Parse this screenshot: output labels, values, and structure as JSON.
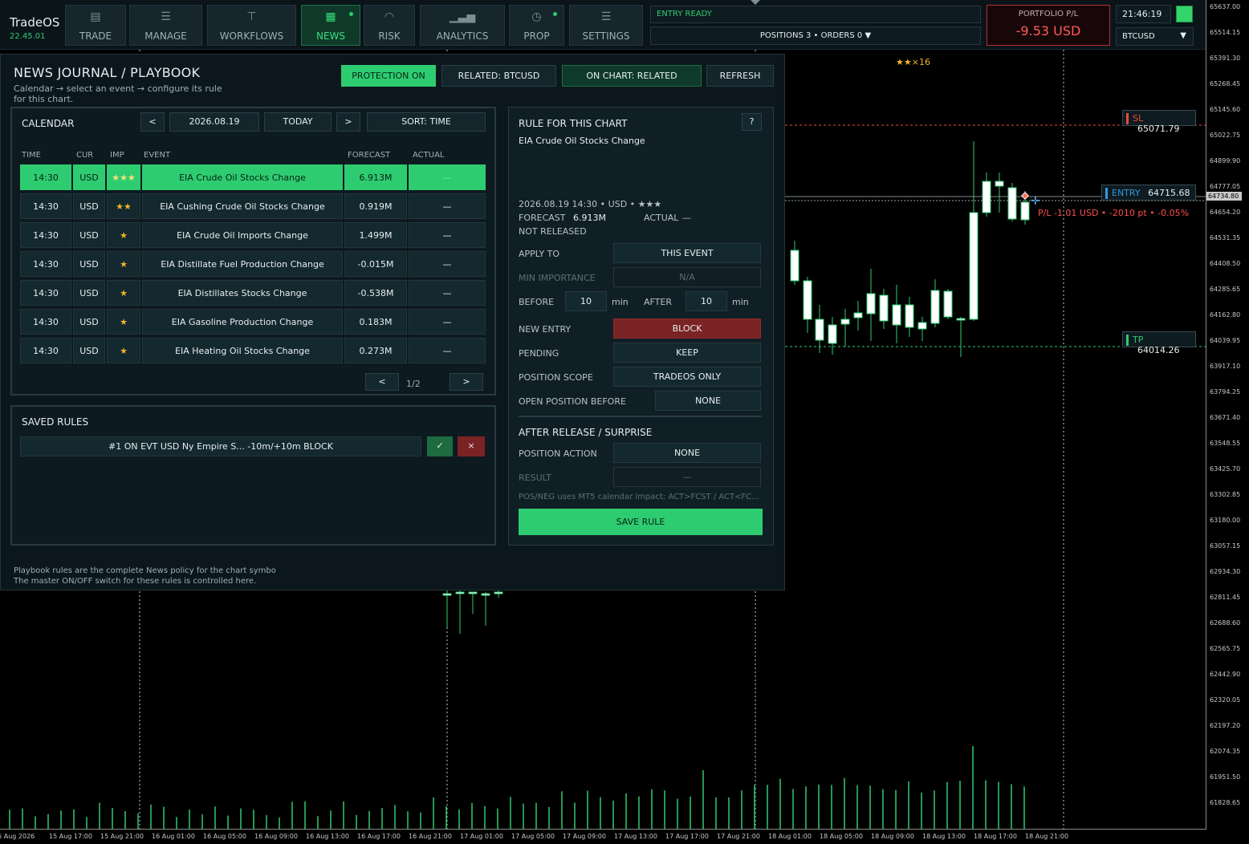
{
  "app": {
    "name": "TradeOS",
    "version": "22.45.01"
  },
  "nav": [
    {
      "label": "TRADE",
      "icon": "document-icon",
      "glyph": "▤",
      "active": false,
      "dot": false
    },
    {
      "label": "MANAGE",
      "icon": "sliders-icon",
      "glyph": "☰",
      "active": false,
      "dot": false
    },
    {
      "label": "WORKFLOWS",
      "icon": "flow-icon",
      "glyph": "⊤",
      "active": false,
      "dot": false
    },
    {
      "label": "NEWS",
      "icon": "calendar-icon",
      "glyph": "▦",
      "active": true,
      "dot": true
    },
    {
      "label": "RISK",
      "icon": "shield-icon",
      "glyph": "◠",
      "active": false,
      "dot": false
    },
    {
      "label": "ANALYTICS",
      "icon": "bar-chart-icon",
      "glyph": "▁▃▅",
      "active": false,
      "dot": false
    },
    {
      "label": "PROP",
      "icon": "timer-icon",
      "glyph": "◷",
      "active": false,
      "dot": true
    },
    {
      "label": "SETTINGS",
      "icon": "settings-sliders-icon",
      "glyph": "☰",
      "active": false,
      "dot": false
    }
  ],
  "status": {
    "entry": "ENTRY READY",
    "positions_orders": "POSITIONS 3  •  ORDERS 0  ▼",
    "portfolio_label": "PORTFOLIO P/L",
    "portfolio_value": "-9.53 USD",
    "clock": "21:46:19",
    "symbol": "BTCUSD"
  },
  "chart": {
    "price_ticks": [
      "65637.00",
      "65514.15",
      "65391.30",
      "65268.45",
      "65145.60",
      "65022.75",
      "64899.90",
      "64777.05",
      "64654.20",
      "64531.35",
      "64408.50",
      "64285.65",
      "64162.80",
      "64039.95",
      "63917.10",
      "63794.25",
      "63671.40",
      "63548.55",
      "63425.70",
      "63302.85",
      "63180.00",
      "63057.15",
      "62934.30",
      "62811.45",
      "62688.60",
      "62565.75",
      "62442.90",
      "62320.05",
      "62197.20",
      "62074.35",
      "61951.50",
      "61828.65"
    ],
    "time_ticks": [
      "15 Aug 2026",
      "15 Aug 17:00",
      "15 Aug 21:00",
      "16 Aug 01:00",
      "16 Aug 05:00",
      "16 Aug 09:00",
      "16 Aug 13:00",
      "16 Aug 17:00",
      "16 Aug 21:00",
      "17 Aug 01:00",
      "17 Aug 05:00",
      "17 Aug 09:00",
      "17 Aug 13:00",
      "17 Aug 17:00",
      "17 Aug 21:00",
      "18 Aug 01:00",
      "18 Aug 05:00",
      "18 Aug 09:00",
      "18 Aug 13:00",
      "18 Aug 17:00",
      "18 Aug 21:00"
    ],
    "sl": {
      "label": "SL",
      "value": "65071.79",
      "color": "#e74c3c"
    },
    "entry": {
      "label": "ENTRY",
      "value": "64715.68",
      "color": "#3498db"
    },
    "tp": {
      "label": "TP",
      "value": "64014.26",
      "color": "#2ecc71"
    },
    "bid_price": "64734.80",
    "pl_text": "P/L -1.01 USD  •  -2010 pt  •  -0.05%",
    "event_marker": "★★×16"
  },
  "panel": {
    "title": "NEWS JOURNAL / PLAYBOOK",
    "subtitle": "Calendar → select an event → configure its rule for this chart.",
    "buttons": {
      "protection": "PROTECTION ON",
      "related": "RELATED: BTCUSD",
      "on_chart": "ON CHART: RELATED",
      "refresh": "REFRESH"
    },
    "calendar": {
      "title": "CALENDAR",
      "prev": "<",
      "date": "2026.08.19",
      "today": "TODAY",
      "next": ">",
      "sort": "SORT: TIME",
      "headers": {
        "time": "TIME",
        "cur": "CUR",
        "imp": "IMP",
        "event": "EVENT",
        "forecast": "FORECAST",
        "actual": "ACTUAL"
      },
      "rows": [
        {
          "time": "14:30",
          "cur": "USD",
          "imp": "★★★",
          "event": "EIA Crude Oil Stocks Change",
          "forecast": "6.913M",
          "actual": "—"
        },
        {
          "time": "14:30",
          "cur": "USD",
          "imp": "★★",
          "event": "EIA Cushing Crude Oil Stocks Change",
          "forecast": "0.919M",
          "actual": "—"
        },
        {
          "time": "14:30",
          "cur": "USD",
          "imp": "★",
          "event": "EIA Crude Oil Imports Change",
          "forecast": "1.499M",
          "actual": "—"
        },
        {
          "time": "14:30",
          "cur": "USD",
          "imp": "★",
          "event": "EIA Distillate Fuel Production Change",
          "forecast": "-0.015M",
          "actual": "—"
        },
        {
          "time": "14:30",
          "cur": "USD",
          "imp": "★",
          "event": "EIA Distillates Stocks Change",
          "forecast": "-0.538M",
          "actual": "—"
        },
        {
          "time": "14:30",
          "cur": "USD",
          "imp": "★",
          "event": "EIA Gasoline Production Change",
          "forecast": "0.183M",
          "actual": "—"
        },
        {
          "time": "14:30",
          "cur": "USD",
          "imp": "★",
          "event": "EIA Heating Oil Stocks Change",
          "forecast": "0.273M",
          "actual": "—"
        }
      ],
      "page_prev": "<",
      "page": "1/2",
      "page_next": ">"
    },
    "saved": {
      "title": "SAVED RULES",
      "rule": "#1 ON EVT USD Ny Empire S...  -10m/+10m BLOCK",
      "ok": "✓",
      "del": "×"
    },
    "rule": {
      "title": "RULE FOR THIS CHART",
      "help": "?",
      "event": "EIA Crude Oil Stocks Change",
      "meta": "2026.08.19 14:30  •  USD  •  ★★★",
      "forecast_label": "FORECAST",
      "forecast_value": "6.913M",
      "actual_label": "ACTUAL",
      "actual_value": "—",
      "state": "NOT RELEASED",
      "apply_label": "APPLY TO",
      "apply_value": "THIS EVENT",
      "min_imp_label": "MIN IMPORTANCE",
      "min_imp_value": "N/A",
      "before_label": "BEFORE",
      "before_value": "10",
      "min1": "min",
      "after_label": "AFTER",
      "after_value": "10",
      "min2": "min",
      "new_entry_label": "NEW ENTRY",
      "new_entry_value": "BLOCK",
      "pending_label": "PENDING",
      "pending_value": "KEEP",
      "scope_label": "POSITION SCOPE",
      "scope_value": "TRADEOS ONLY",
      "open_before_label": "OPEN POSITION BEFORE",
      "open_before_value": "NONE",
      "after_release_title": "AFTER RELEASE / SURPRISE",
      "pos_action_label": "POSITION ACTION",
      "pos_action_value": "NONE",
      "result_label": "RESULT",
      "result_value": "—",
      "note": "POS/NEG uses MT5 calendar impact; ACT>FCST / ACT<FC...",
      "save": "SAVE RULE"
    },
    "footnote1": "Playbook rules are the complete News policy for the chart symbo",
    "footnote2": "The master ON/OFF switch for these rules is controlled here."
  }
}
